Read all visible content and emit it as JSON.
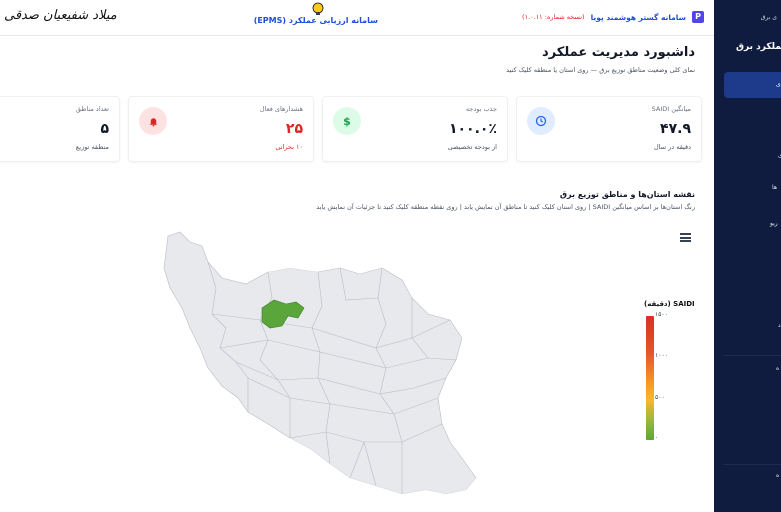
{
  "topbar": {
    "signature": "میلاد شفیعیان صدقی",
    "center_title": "سامانه ارزیابی عملکرد (EPMS)",
    "brand_name": "سامانه گستر هوشمند پویا",
    "brand_logo_letter": "P",
    "version": "(نسخه شماره: ۱.۰.۱۱)"
  },
  "sidebar": {
    "top_text": "ی برق",
    "title": "عملکرد برق",
    "active_item": "ی",
    "items": [
      "ی",
      "ها",
      "ریو",
      "د",
      "ه",
      "ه"
    ]
  },
  "header": {
    "title": "داشبورد مدیریت عملکرد",
    "subtitle": "نمای کلی وضعیت مناطق توزیع برق — روی استان یا منطقه کلیک کنید"
  },
  "cards": [
    {
      "label": "میانگین SAIDI",
      "value": "۴۷.۹",
      "note": "دقیقه در سال",
      "icon": "clock-icon",
      "icon_bg": "#e0ecff",
      "icon_color": "#2563eb",
      "value_color": "#111827",
      "note_color": "#4b5563"
    },
    {
      "label": "جذب بودجه",
      "value": "۱۰۰.۰٪",
      "note": "از بودجه تخصیصی",
      "icon": "dollar-icon",
      "icon_bg": "#dcfce7",
      "icon_color": "#16a34a",
      "value_color": "#111827",
      "note_color": "#4b5563"
    },
    {
      "label": "هشدارهای فعال",
      "value": "۲۵",
      "note": "۱۰ بحرانی",
      "icon": "bell-icon",
      "icon_bg": "#fde2e2",
      "icon_color": "#dc2626",
      "value_color": "#dc2626",
      "note_color": "#dc2626"
    },
    {
      "label": "تعداد مناطق",
      "value": "۵",
      "note": "منطقه توزیع",
      "icon": "",
      "icon_bg": "",
      "icon_color": "",
      "value_color": "#111827",
      "note_color": "#4b5563"
    }
  ],
  "map_section": {
    "title": "نقشه استان‌ها و مناطق توزیع برق",
    "subtitle": "رنگ استان‌ها بر اساس میانگین SAIDI | روی استان کلیک کنید تا مناطق آن نمایش یابد | روی نقطه منطقه کلیک کنید تا جزئیات آن نمایش یابد",
    "legend_title": "SAIDI (دقیقه)",
    "legend_ticks": [
      "۱۵۰۰",
      "۱۰۰۰",
      "۵۰۰",
      "۰"
    ],
    "highlight_color": "#5aa63a",
    "province_color": "#e8e9ec"
  },
  "colors": {
    "sidebar_bg": "#0f1c3f",
    "accent": "#1d4ed8"
  }
}
